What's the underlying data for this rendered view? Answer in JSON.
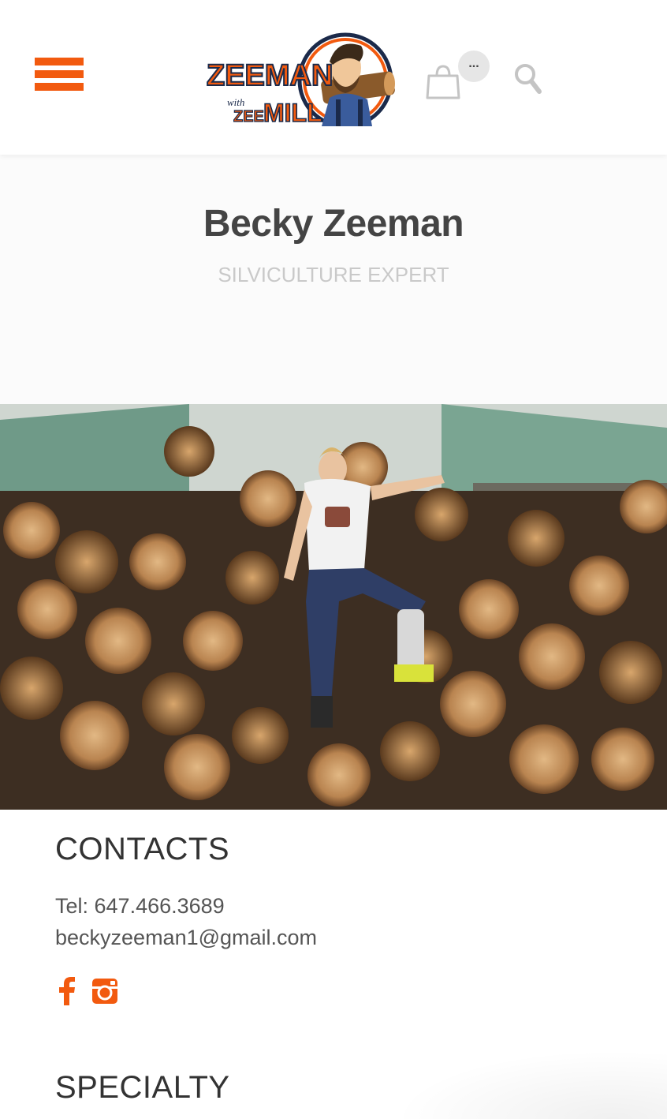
{
  "header": {
    "menu_icon": "hamburger-icon",
    "logo": {
      "line1": "ZEEMAN",
      "line2": "with",
      "line3": "ZEE",
      "line4": "MILL"
    },
    "cart_icon": "shopping-bag-icon",
    "cart_badge": "...",
    "search_icon": "search-icon",
    "accent_color": "#f25a0f"
  },
  "profile": {
    "name": "Becky Zeeman",
    "role": "SILVICULTURE EXPERT"
  },
  "contacts": {
    "heading": "CONTACTS",
    "tel": "Tel: 647.466.3689",
    "email": "beckyzeeman1@gmail.com",
    "social": [
      "facebook-icon",
      "instagram-icon"
    ]
  },
  "specialty": {
    "heading": "SPECIALTY"
  }
}
